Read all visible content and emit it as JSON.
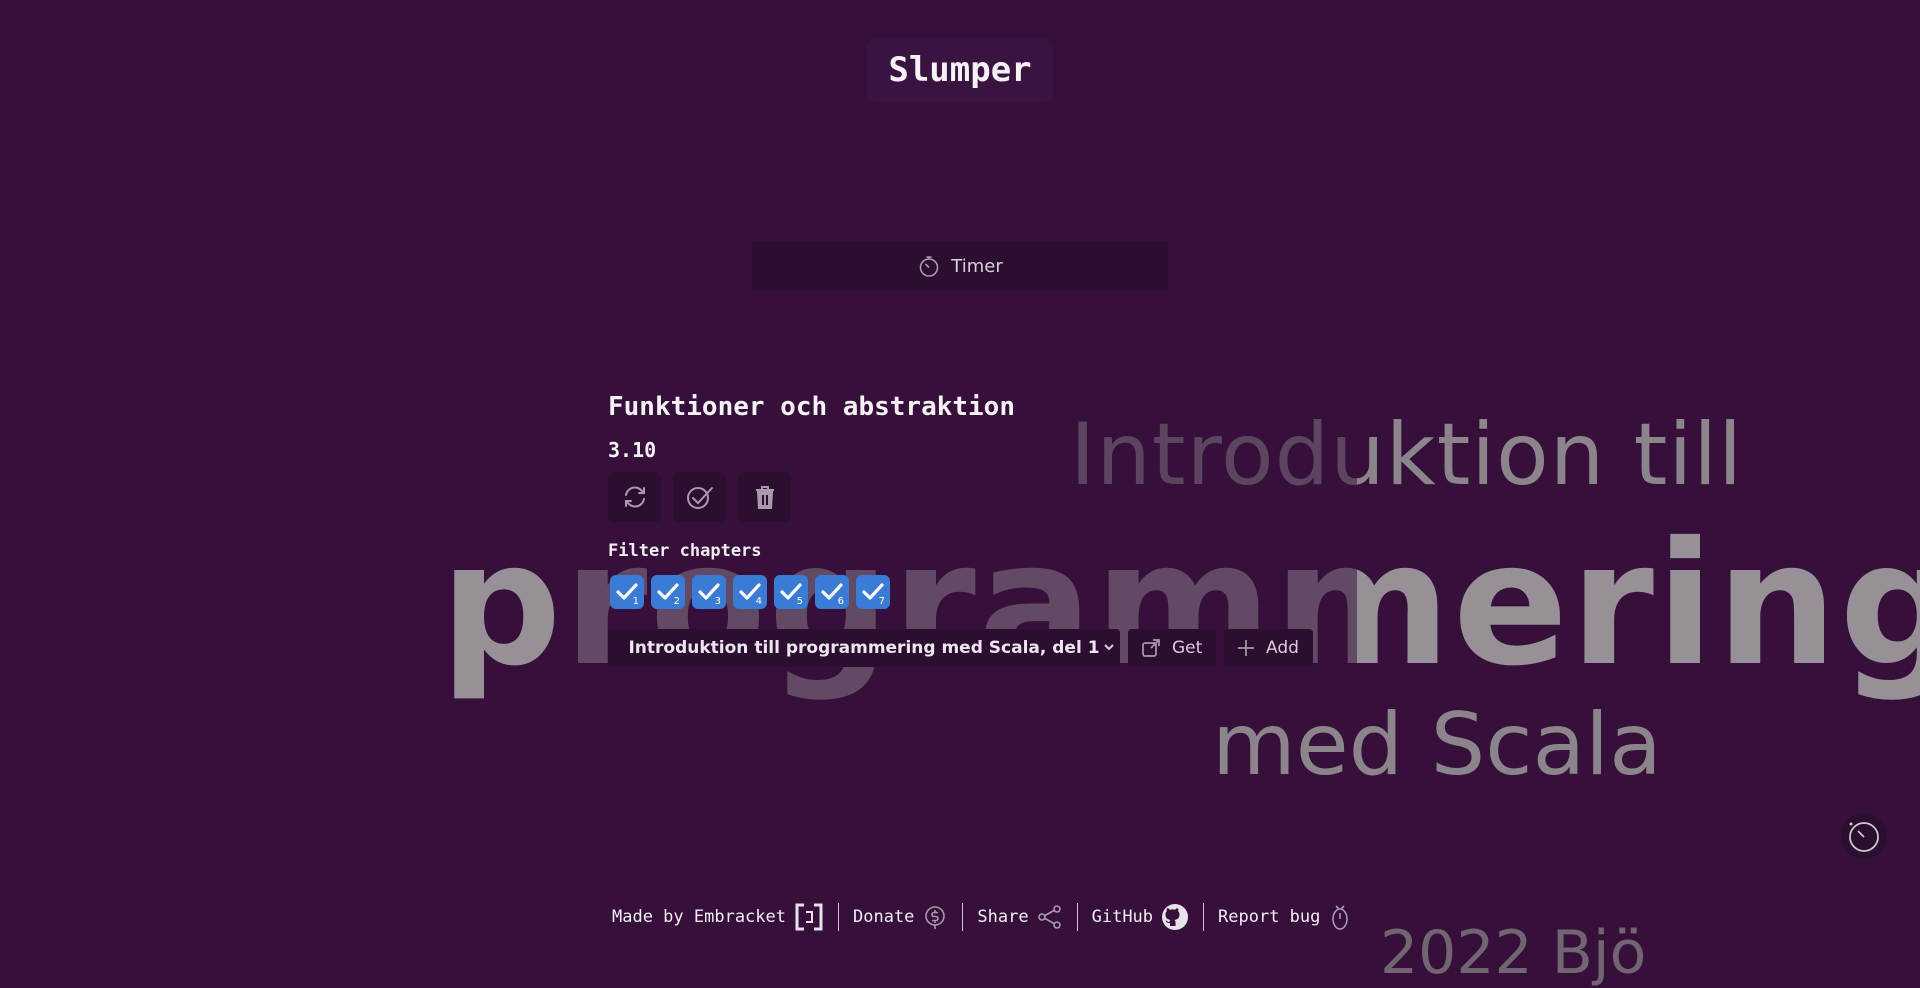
{
  "app": {
    "title": "Slumper"
  },
  "background_art": {
    "line1": "Introduktion till",
    "line2": "programmering",
    "line3": "med Scala",
    "line4": "2022 Bjö"
  },
  "timer": {
    "label": "Timer",
    "icon": "stopwatch-icon"
  },
  "topic": {
    "title": "Funktioner och abstraktion",
    "number": "3.10",
    "actions": [
      {
        "icon": "refresh-icon"
      },
      {
        "icon": "checkmark-done-icon"
      },
      {
        "icon": "trash-icon"
      }
    ]
  },
  "filter": {
    "label": "Filter chapters",
    "chapters": [
      {
        "number": "1",
        "checked": true
      },
      {
        "number": "2",
        "checked": true
      },
      {
        "number": "3",
        "checked": true
      },
      {
        "number": "4",
        "checked": true
      },
      {
        "number": "5",
        "checked": true
      },
      {
        "number": "6",
        "checked": true
      },
      {
        "number": "7",
        "checked": true
      }
    ]
  },
  "course_select": {
    "selected": "Introduktion till programmering med Scala, del 1",
    "get_label": "Get",
    "add_label": "Add"
  },
  "footer": {
    "made_by": "Made by Embracket",
    "donate": "Donate",
    "share": "Share",
    "github": "GitHub",
    "report_bug": "Report bug"
  },
  "colors": {
    "background": "#36103b",
    "panel": "#2c0f30",
    "checkbox": "#3a7bd5",
    "text": "#f3eef4"
  }
}
